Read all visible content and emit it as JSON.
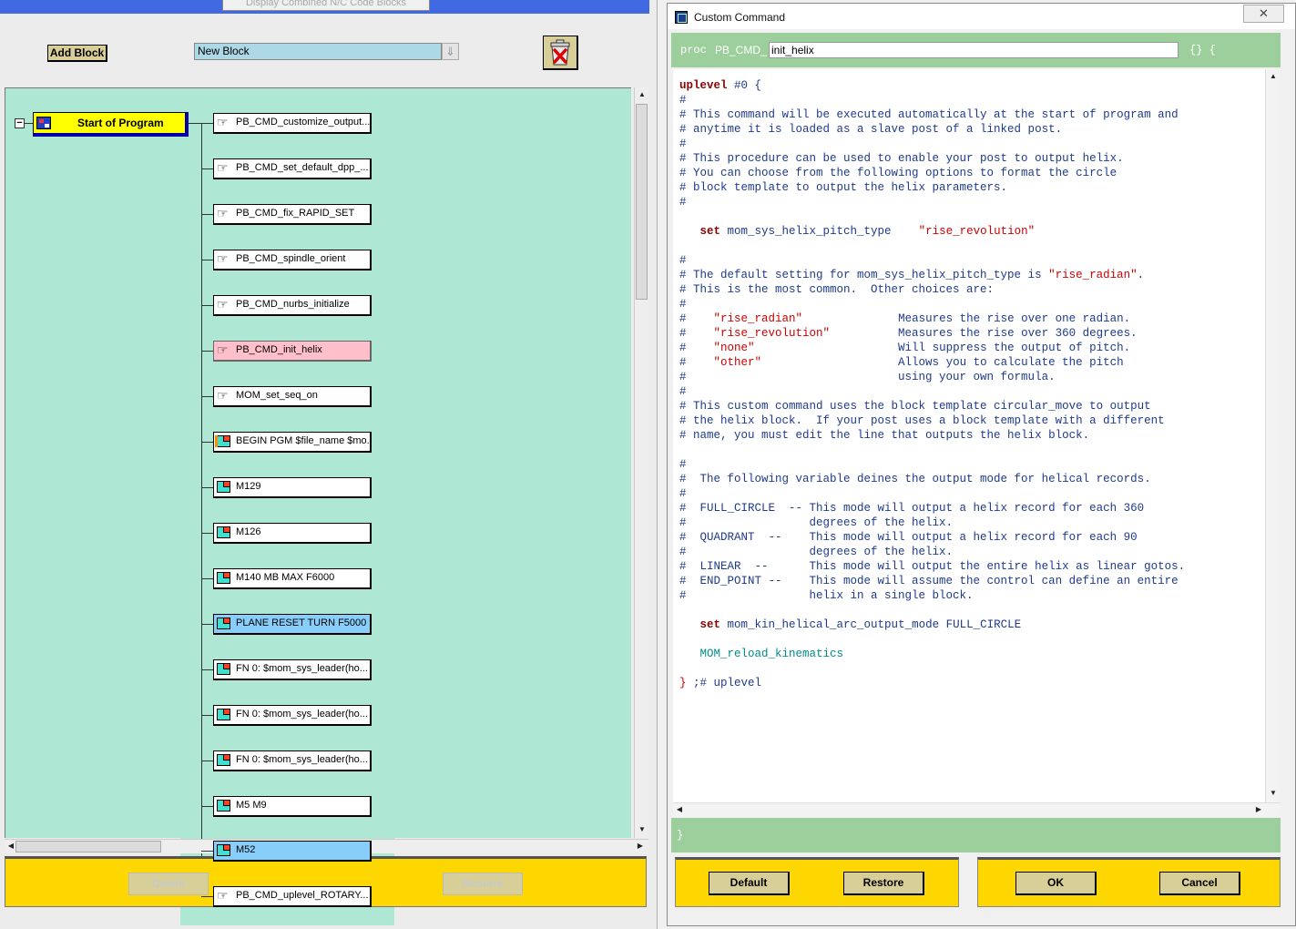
{
  "left_panel": {
    "top_button_label": "Display Combined N/C Code Blocks",
    "add_block_label": "Add Block",
    "new_block_value": "New Block",
    "bottom_left_button": "Delete",
    "bottom_right_button": "Restore"
  },
  "tree": {
    "root_label": "Start of Program",
    "items": [
      {
        "label": "PB_CMD_customize_output..."
      },
      {
        "label": "PB_CMD_set_default_dpp_..."
      },
      {
        "label": "PB_CMD_fix_RAPID_SET"
      },
      {
        "label": "PB_CMD_spindle_orient"
      },
      {
        "label": "PB_CMD_nurbs_initialize"
      },
      {
        "label": "PB_CMD_init_helix"
      },
      {
        "label": "MOM_set_seq_on"
      },
      {
        "label": "BEGIN PGM $file_name $mo..."
      },
      {
        "label": "M129"
      },
      {
        "label": "M126"
      },
      {
        "label": "M140 MB MAX F6000"
      },
      {
        "label": "PLANE RESET TURN F5000"
      },
      {
        "label": "FN 0: $mom_sys_leader(ho..."
      },
      {
        "label": "FN 0: $mom_sys_leader(ho..."
      },
      {
        "label": "FN 0: $mom_sys_leader(ho..."
      },
      {
        "label": "M5 M9"
      },
      {
        "label": "M52"
      },
      {
        "label": "PB_CMD_uplevel_ROTARY..."
      }
    ]
  },
  "dialog": {
    "title": "Custom Command",
    "close_glyph": "✕",
    "proc_keyword": "proc",
    "proc_prefix": "PB_CMD_",
    "proc_name": "init_helix",
    "proc_braces": "{} {",
    "closing_brace": "}",
    "buttons": {
      "default": "Default",
      "restore": "Restore",
      "ok": "OK",
      "cancel": "Cancel"
    }
  },
  "code_lines": [
    [
      [
        "b",
        "uplevel"
      ],
      [
        "n",
        " #0 {"
      ]
    ],
    [
      [
        "n",
        "#"
      ]
    ],
    [
      [
        "n",
        "# This command will be executed automatically at the start of program and"
      ]
    ],
    [
      [
        "n",
        "# anytime it is loaded as a slave post of a linked post."
      ]
    ],
    [
      [
        "n",
        "#"
      ]
    ],
    [
      [
        "n",
        "# This procedure can be used to enable your post to output helix."
      ]
    ],
    [
      [
        "n",
        "# You can choose from the following options to format the circle"
      ]
    ],
    [
      [
        "n",
        "# block template to output the helix parameters."
      ]
    ],
    [
      [
        "n",
        "#"
      ]
    ],
    [
      [
        "n",
        ""
      ]
    ],
    [
      [
        "n",
        "   "
      ],
      [
        "b",
        "set"
      ],
      [
        "n",
        " mom_sys_helix_pitch_type    "
      ],
      [
        "s",
        "\"rise_revolution\""
      ]
    ],
    [
      [
        "n",
        ""
      ]
    ],
    [
      [
        "n",
        "#"
      ]
    ],
    [
      [
        "n",
        "# The default setting for mom_sys_helix_pitch_type is "
      ],
      [
        "s",
        "\"rise_radian\""
      ],
      [
        "n",
        "."
      ]
    ],
    [
      [
        "n",
        "# This is the most common.  Other choices are:"
      ]
    ],
    [
      [
        "n",
        "#"
      ]
    ],
    [
      [
        "n",
        "#    "
      ],
      [
        "s",
        "\"rise_radian\""
      ],
      [
        "n",
        "              Measures the rise over one radian."
      ]
    ],
    [
      [
        "n",
        "#    "
      ],
      [
        "s",
        "\"rise_revolution\""
      ],
      [
        "n",
        "          Measures the rise over 360 degrees."
      ]
    ],
    [
      [
        "n",
        "#    "
      ],
      [
        "s",
        "\"none\""
      ],
      [
        "n",
        "                     Will suppress the output of pitch."
      ]
    ],
    [
      [
        "n",
        "#    "
      ],
      [
        "s",
        "\"other\""
      ],
      [
        "n",
        "                    Allows you to calculate the pitch"
      ]
    ],
    [
      [
        "n",
        "#                               using your own formula."
      ]
    ],
    [
      [
        "n",
        "#"
      ]
    ],
    [
      [
        "n",
        "# This custom command uses the block template circular_move to output"
      ]
    ],
    [
      [
        "n",
        "# the helix block.  If your post uses a block template with a different"
      ]
    ],
    [
      [
        "n",
        "# name, you must edit the line that outputs the helix block."
      ]
    ],
    [
      [
        "n",
        ""
      ]
    ],
    [
      [
        "n",
        "#"
      ]
    ],
    [
      [
        "n",
        "#  The following variable deines the output mode for helical records."
      ]
    ],
    [
      [
        "n",
        "#"
      ]
    ],
    [
      [
        "n",
        "#  FULL_CIRCLE  -- This mode will output a helix record for each 360"
      ]
    ],
    [
      [
        "n",
        "#                  degrees of the helix."
      ]
    ],
    [
      [
        "n",
        "#  QUADRANT  --    This mode will output a helix record for each 90"
      ]
    ],
    [
      [
        "n",
        "#                  degrees of the helix."
      ]
    ],
    [
      [
        "n",
        "#  LINEAR  --      This mode will output the entire helix as linear gotos."
      ]
    ],
    [
      [
        "n",
        "#  END_POINT --    This mode will assume the control can define an entire"
      ]
    ],
    [
      [
        "n",
        "#                  helix in a single block."
      ]
    ],
    [
      [
        "n",
        ""
      ]
    ],
    [
      [
        "n",
        "   "
      ],
      [
        "b",
        "set"
      ],
      [
        "n",
        " mom_kin_helical_arc_output_mode FULL_CIRCLE"
      ]
    ],
    [
      [
        "n",
        ""
      ]
    ],
    [
      [
        "t",
        "   MOM_reload_kinematics"
      ]
    ],
    [
      [
        "n",
        ""
      ]
    ],
    [
      [
        "r",
        "}"
      ],
      [
        "n",
        " ;# uplevel"
      ]
    ]
  ],
  "colors": {
    "canvas_bg": "#aee8d4",
    "yellow_bar": "#ffd700",
    "green_bar": "#9ccf9c",
    "code_text": "#1e3a8a",
    "string": "#cc0000",
    "selected_pink": "#ffc0cb",
    "selected_blue": "#87cefa"
  }
}
